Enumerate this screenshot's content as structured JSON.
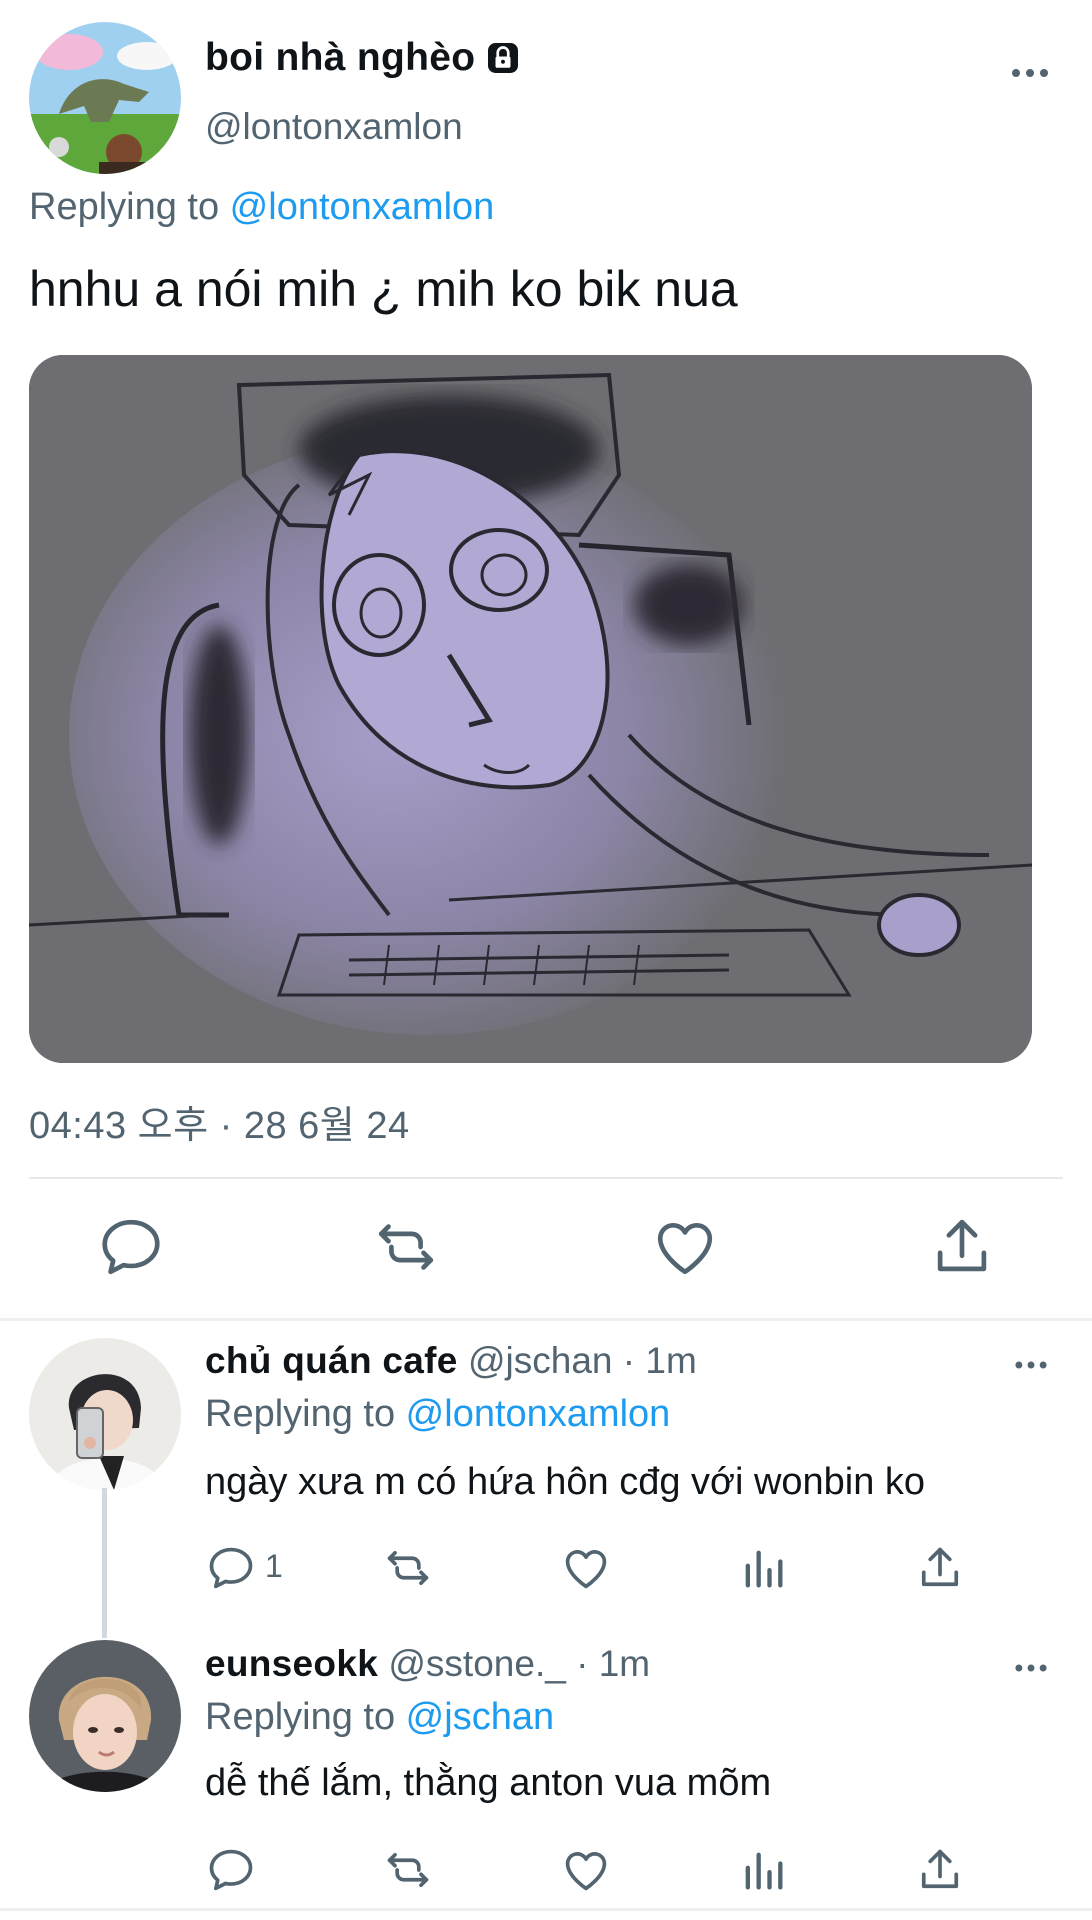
{
  "main_tweet": {
    "author_name": "boi nhà nghèo",
    "handle": "@lontonxamlon",
    "replying_prefix": "Replying to ",
    "replying_to": "@lontonxamlon",
    "text": "hnhu a nói mih ¿ mih ko bik nua",
    "timestamp": "04:43 오후 · 28 6월 24",
    "lock_icon": "lock-icon",
    "actions": [
      "reply-icon",
      "retweet-icon",
      "like-icon",
      "share-icon"
    ]
  },
  "replies": [
    {
      "name": "chủ quán cafe",
      "handle": "@jschan",
      "time": " · 1m",
      "replying_prefix": "Replying to ",
      "replying_to": "@lontonxamlon",
      "text": "ngày xưa m có hứa hôn cđg với wonbin ko",
      "reply_count": "1"
    },
    {
      "name": "eunseokk",
      "handle": "@sstone._",
      "time": " · 1m",
      "replying_prefix": "Replying to ",
      "replying_to": "@jschan",
      "text": "dễ thế lắm, thằng anton vua mõm",
      "reply_count": ""
    }
  ],
  "colors": {
    "accent": "#1d9bf0",
    "secondary_text": "#536471",
    "icon": "#536471"
  }
}
